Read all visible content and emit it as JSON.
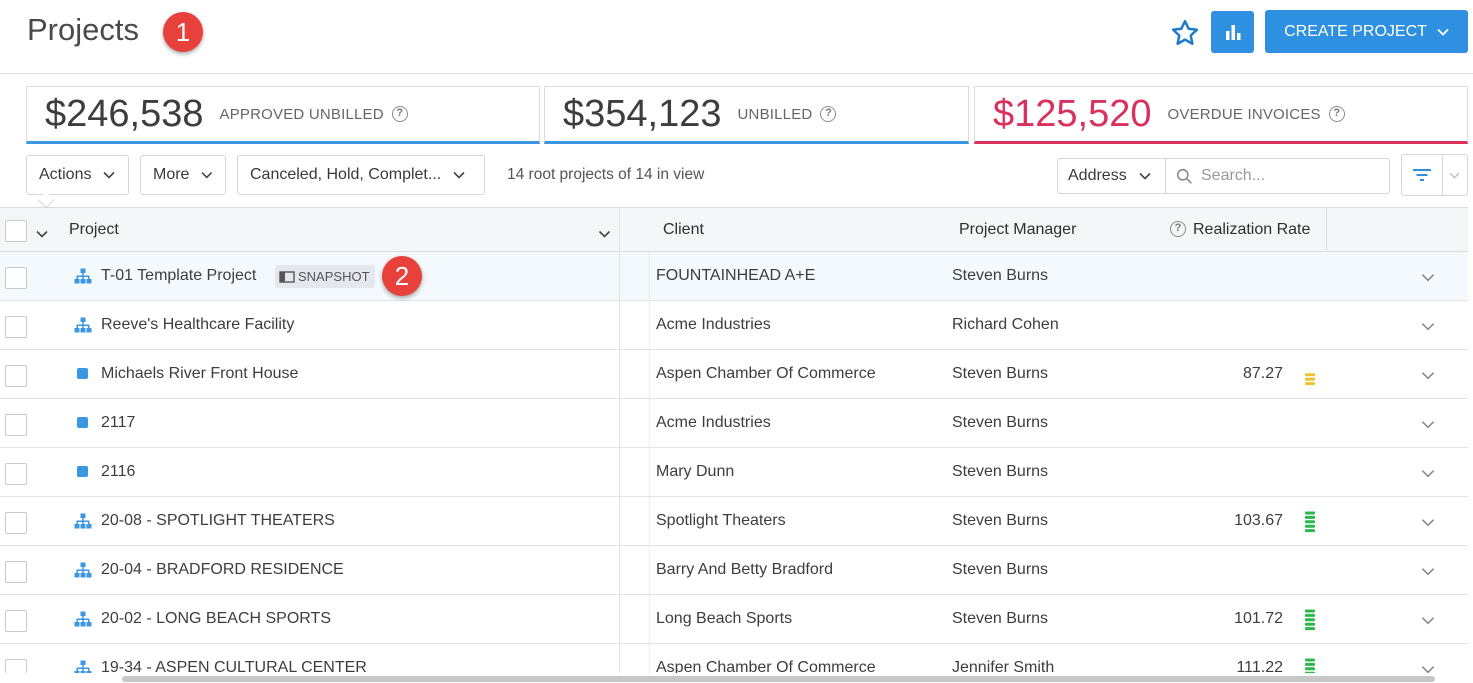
{
  "header": {
    "title": "Projects",
    "create_label": "CREATE PROJECT",
    "callout_1": "1",
    "callout_2": "2"
  },
  "kpis": [
    {
      "value": "$246,538",
      "label": "APPROVED UNBILLED"
    },
    {
      "value": "$354,123",
      "label": "UNBILLED"
    },
    {
      "value": "$125,520",
      "label": "OVERDUE INVOICES"
    }
  ],
  "toolbar": {
    "actions_label": "Actions",
    "more_label": "More",
    "status_filter": "Canceled, Hold, Complet...",
    "count_text": "14 root projects of 14 in view",
    "address_label": "Address",
    "search_placeholder": "Search..."
  },
  "columns": {
    "project": "Project",
    "client": "Client",
    "pm": "Project Manager",
    "rate": "Realization Rate"
  },
  "rows": [
    {
      "type": "hierarchy",
      "name": "T-01 Template Project",
      "badge": "SNAPSHOT",
      "client": "FOUNTAINHEAD A+E",
      "pm": "Steven Burns",
      "rate": ""
    },
    {
      "type": "hierarchy",
      "name": "Reeve's Healthcare Facility",
      "client": "Acme Industries",
      "pm": "Richard Cohen",
      "rate": ""
    },
    {
      "type": "single",
      "name": "Michaels River Front House",
      "client": "Aspen Chamber Of Commerce",
      "pm": "Steven Burns",
      "rate": "87.27",
      "rate_status": "yellow"
    },
    {
      "type": "single",
      "name": "2117",
      "client": "Acme Industries",
      "pm": "Steven Burns",
      "rate": ""
    },
    {
      "type": "single",
      "name": "2116",
      "client": "Mary Dunn",
      "pm": "Steven Burns",
      "rate": ""
    },
    {
      "type": "hierarchy",
      "name": "20-08 - SPOTLIGHT THEATERS",
      "client": "Spotlight Theaters",
      "pm": "Steven Burns",
      "rate": "103.67",
      "rate_status": "green"
    },
    {
      "type": "hierarchy",
      "name": "20-04 - BRADFORD RESIDENCE",
      "client": "Barry And Betty Bradford",
      "pm": "Steven Burns",
      "rate": ""
    },
    {
      "type": "hierarchy",
      "name": "20-02 - LONG BEACH SPORTS",
      "client": "Long Beach Sports",
      "pm": "Steven Burns",
      "rate": "101.72",
      "rate_status": "green"
    },
    {
      "type": "hierarchy",
      "name": "19-34 - ASPEN CULTURAL CENTER",
      "client": "Aspen Chamber Of Commerce",
      "pm": "Jennifer Smith",
      "rate": "111.22",
      "rate_status": "green"
    }
  ],
  "colors": {
    "accent": "#2f8fe0",
    "overdue": "#d9305d",
    "rate_green": "#2db84d",
    "rate_yellow": "#f2c12e",
    "callout": "#e8403a"
  },
  "icons": {
    "favorite": "star-icon",
    "reports": "bar-chart-icon",
    "hierarchy": "hierarchy-icon",
    "single": "square-project-icon",
    "search": "search-icon",
    "filter": "filter-icon",
    "expand": "chevron-down-icon"
  }
}
